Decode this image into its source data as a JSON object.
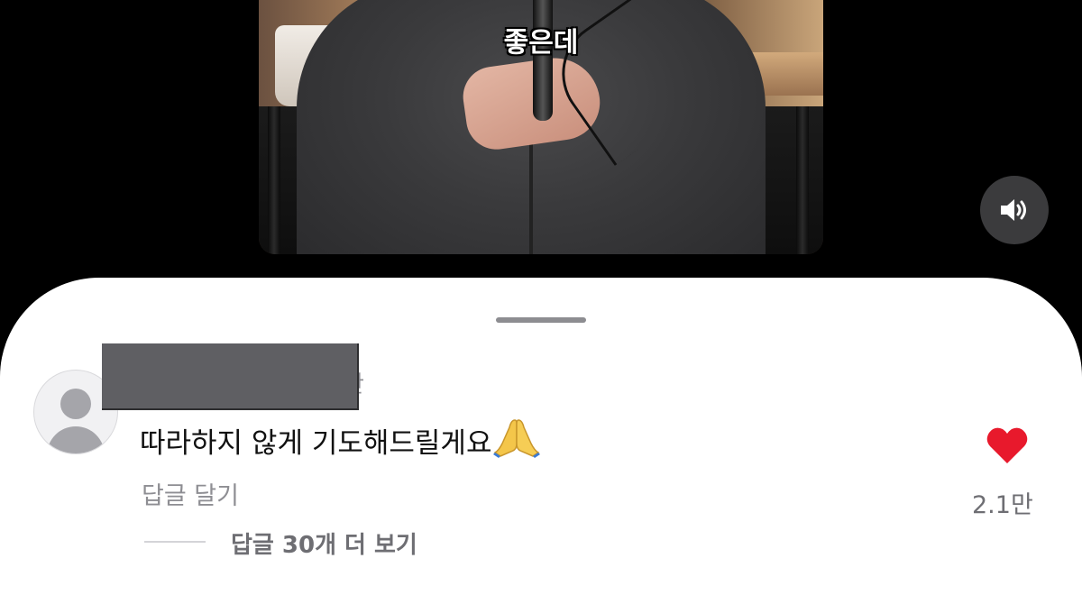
{
  "video": {
    "subtitle": "좋은데",
    "sound_icon": "speaker-volume-icon"
  },
  "comment": {
    "username_visible_tail": "안",
    "text": "따라하지 않게 기도해드릴게요",
    "emoji": "🙏",
    "reply_label": "답글 달기",
    "like_icon": "heart-filled-icon",
    "like_color": "#e8192c",
    "like_count": "2.1만",
    "more_replies_label": "답글 30개 더 보기"
  },
  "colors": {
    "sheet_bg": "#ffffff",
    "screen_bg": "#000000",
    "secondary_text": "#8e8e93"
  }
}
